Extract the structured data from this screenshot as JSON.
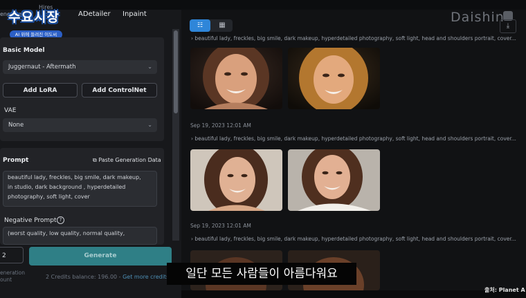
{
  "tabs": {
    "generate": "enerate",
    "hires": "Hires",
    "adetailer": "ADetailer",
    "inpaint": "Inpaint"
  },
  "logo": {
    "title": "수요시장",
    "subtitle": "AI 위에 들려진 이도씨"
  },
  "model": {
    "label": "Basic Model",
    "value": "Juggernaut - Aftermath",
    "add_lora": "Add LoRA",
    "add_controlnet": "Add ControlNet"
  },
  "vae": {
    "label": "VAE",
    "value": "None"
  },
  "prompt": {
    "label": "Prompt",
    "paste_label": "Paste Generation Data",
    "value": "beautiful lady, freckles, big smile, dark makeup,\nin studio, dark background , hyperdetailed\nphotography, soft light,  cover",
    "negative_label": "Negative Prompt",
    "negative_value": "(worst quality, low quality, normal quality,"
  },
  "generate": {
    "count": "2",
    "label": "Generate",
    "credits_text": "2 Credits balance: 196.00 - ",
    "get_more": "Get more credits",
    "meta_line1": "eneration",
    "meta_line2": "ount"
  },
  "gallery": {
    "view_list": "☷",
    "view_grid": "▦",
    "watermark": "Daishin",
    "prompt_text": "beautiful lady, freckles, big smile, dark makeup, hyperdetailed photography, soft light, head and shoulders portrait, cover...",
    "groups": [
      {
        "date": ""
      },
      {
        "date": "Sep 19, 2023 12:01 AM"
      },
      {
        "date": "Sep 19, 2023 12:01 AM"
      }
    ]
  },
  "caption": {
    "subtitle": "일단 모든 사람들이 아름다워요",
    "source": "출처: Planet A"
  },
  "colors": {
    "accent": "#2f86d9",
    "generate": "#2f7f86",
    "panel": "#222327"
  }
}
